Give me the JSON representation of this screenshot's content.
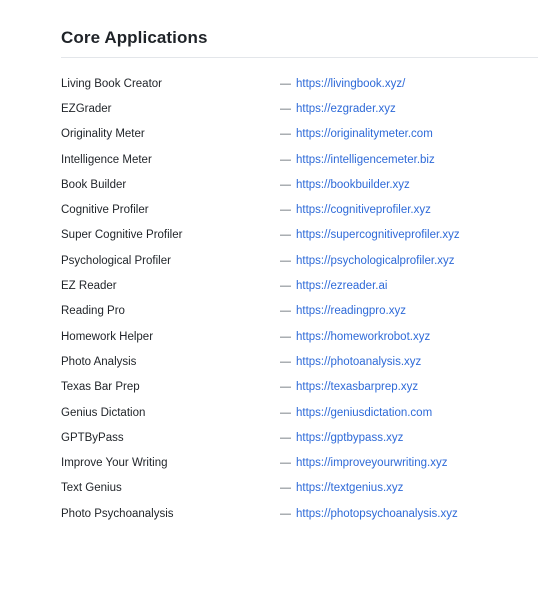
{
  "section": {
    "title": "Core Applications"
  },
  "apps": [
    {
      "name": "Living Book Creator",
      "dash": "—",
      "url": "https://livingbook.xyz/"
    },
    {
      "name": "EZGrader",
      "dash": "—",
      "url": "https://ezgrader.xyz"
    },
    {
      "name": "Originality Meter",
      "dash": "—",
      "url": "https://originalitymeter.com"
    },
    {
      "name": "Intelligence Meter",
      "dash": "—",
      "url": "https://intelligencemeter.biz"
    },
    {
      "name": "Book Builder",
      "dash": "—",
      "url": "https://bookbuilder.xyz"
    },
    {
      "name": "Cognitive Profiler",
      "dash": "—",
      "url": "https://cognitiveprofiler.xyz"
    },
    {
      "name": "Super Cognitive Profiler",
      "dash": "—",
      "url": "https://supercognitiveprofiler.xyz"
    },
    {
      "name": "Psychological Profiler",
      "dash": "—",
      "url": "https://psychologicalprofiler.xyz"
    },
    {
      "name": "EZ Reader",
      "dash": "—",
      "url": "https://ezreader.ai"
    },
    {
      "name": "Reading Pro",
      "dash": "—",
      "url": "https://readingpro.xyz"
    },
    {
      "name": "Homework Helper",
      "dash": "—",
      "url": "https://homeworkrobot.xyz"
    },
    {
      "name": "Photo Analysis",
      "dash": "—",
      "url": "https://photoanalysis.xyz"
    },
    {
      "name": "Texas Bar Prep",
      "dash": "—",
      "url": "https://texasbarprep.xyz"
    },
    {
      "name": "Genius Dictation",
      "dash": "—",
      "url": "https://geniusdictation.com"
    },
    {
      "name": "GPTByPass",
      "dash": "—",
      "url": "https://gptbypass.xyz"
    },
    {
      "name": "Improve Your Writing",
      "dash": "—",
      "url": "https://improveyourwriting.xyz"
    },
    {
      "name": "Text Genius",
      "dash": "—",
      "url": "https://textgenius.xyz"
    },
    {
      "name": "Photo Psychoanalysis",
      "dash": "—",
      "url": "https://photopsychoanalysis.xyz"
    }
  ]
}
